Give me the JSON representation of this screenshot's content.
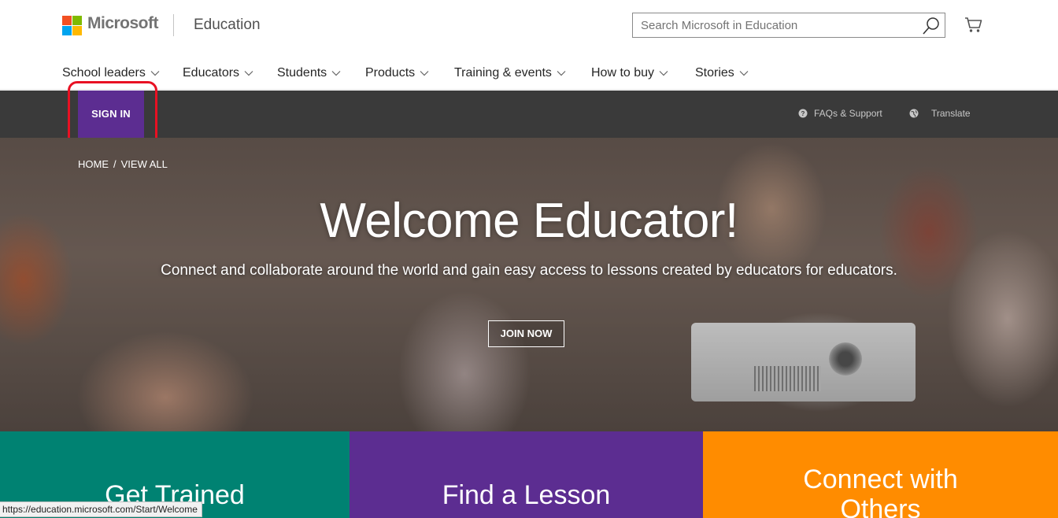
{
  "header": {
    "brand": "Microsoft",
    "section": "Education",
    "search": {
      "placeholder": "Search Microsoft in Education",
      "value": ""
    }
  },
  "nav": {
    "items": [
      {
        "label": "School leaders"
      },
      {
        "label": "Educators"
      },
      {
        "label": "Students"
      },
      {
        "label": "Products"
      },
      {
        "label": "Training & events"
      },
      {
        "label": "How to buy"
      },
      {
        "label": "Stories"
      }
    ]
  },
  "utility_bar": {
    "sign_in": "SIGN IN",
    "faqs": "FAQs & Support",
    "translate": "Translate"
  },
  "hero": {
    "breadcrumb": {
      "home": "HOME",
      "separator": "/",
      "current": "VIEW ALL"
    },
    "title": "Welcome Educator!",
    "subtitle": "Connect and collaborate around the world and gain easy access to lessons created by educators for educators.",
    "cta": "JOIN NOW"
  },
  "tiles": [
    {
      "label": "Get Trained",
      "color": "#008272"
    },
    {
      "label": "Find a Lesson",
      "color": "#5c2d91"
    },
    {
      "label": "Connect with Others",
      "color": "#ff8c00"
    }
  ],
  "status_bar": {
    "url": "https://education.microsoft.com/Start/Welcome"
  },
  "colors": {
    "accent_purple": "#5c2d91",
    "dark_bar": "#3a3a3a",
    "highlight_red": "#e81123"
  }
}
